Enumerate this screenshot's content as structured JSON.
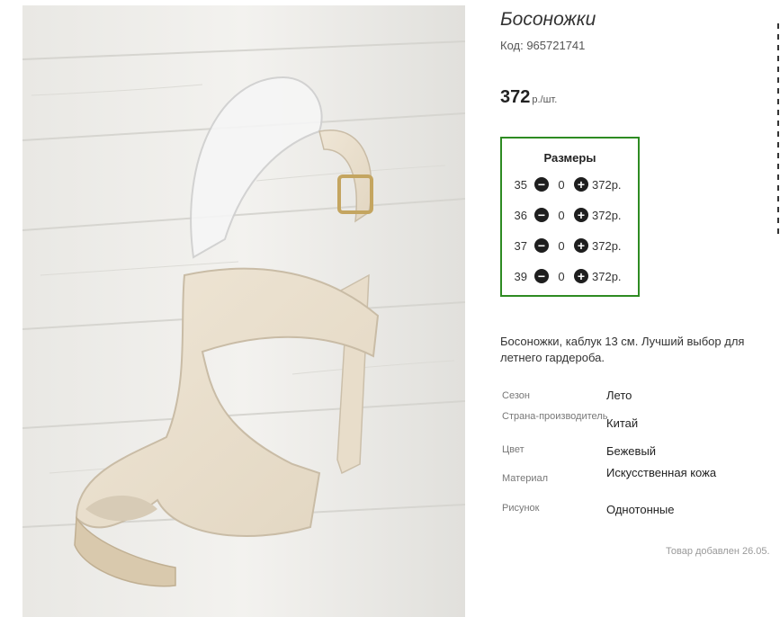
{
  "product": {
    "title": "Босоножки",
    "code": "Код: 965721741",
    "price_value": "372",
    "price_unit": "р./шт."
  },
  "sizes": {
    "title": "Размеры",
    "rows": [
      {
        "size": "35",
        "qty": "0",
        "price": "372р."
      },
      {
        "size": "36",
        "qty": "0",
        "price": "372р."
      },
      {
        "size": "37",
        "qty": "0",
        "price": "372р."
      },
      {
        "size": "39",
        "qty": "0",
        "price": "372р."
      }
    ]
  },
  "description": "Босоножки, каблук 13 см. Лучший выбор для летнего гардероба.",
  "attributes": [
    {
      "key": "Сезон",
      "value": "Лето"
    },
    {
      "key": "Страна-производитель",
      "value": "Китай"
    },
    {
      "key": "Цвет",
      "value": "Бежевый"
    },
    {
      "key": "Материал",
      "value": "Искусственная кожа"
    },
    {
      "key": "Рисунок",
      "value": "Однотонные"
    }
  ],
  "added": "Товар добавлен 26.05.",
  "icons": {
    "minus": "minus-circle-icon",
    "plus": "plus-circle-icon"
  },
  "colors": {
    "sizes_border": "#2e8b22",
    "button": "#1e1e1e"
  }
}
